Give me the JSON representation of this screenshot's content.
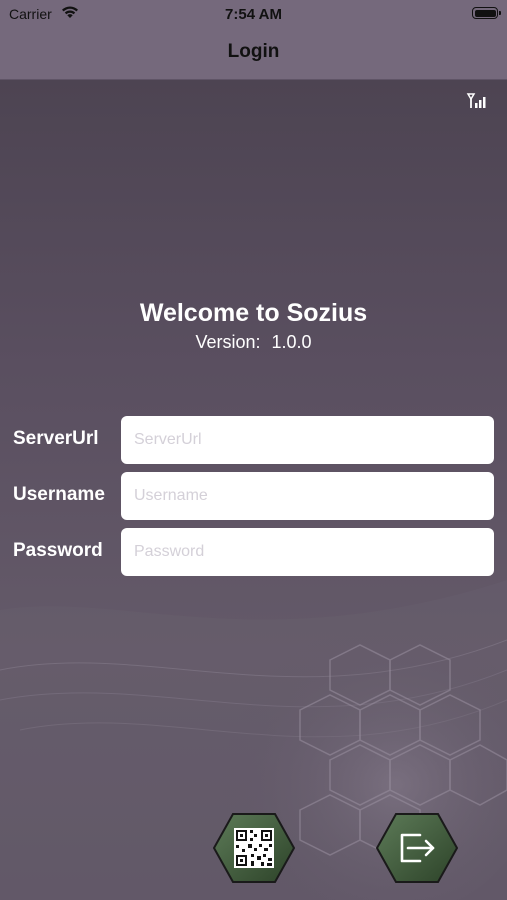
{
  "status_bar": {
    "carrier": "Carrier",
    "time": "7:54 AM"
  },
  "nav": {
    "title": "Login"
  },
  "header": {
    "welcome": "Welcome to Sozius",
    "version_label": "Version:",
    "version_value": "1.0.0"
  },
  "form": {
    "server_url": {
      "label": "ServerUrl",
      "placeholder": "ServerUrl",
      "value": ""
    },
    "username": {
      "label": "Username",
      "placeholder": "Username",
      "value": ""
    },
    "password": {
      "label": "Password",
      "placeholder": "Password",
      "value": ""
    }
  },
  "buttons": {
    "qr": {
      "icon": "qr-code-icon",
      "color": "#3f5a3c"
    },
    "login": {
      "icon": "login-exit-icon",
      "color": "#3f5a3c"
    }
  },
  "icons": {
    "network": "signal-icon",
    "wifi": "wifi-icon",
    "battery": "battery-icon"
  }
}
